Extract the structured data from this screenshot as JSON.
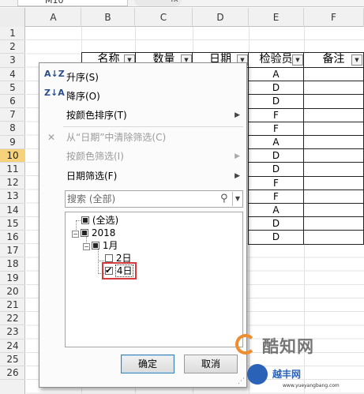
{
  "formula_bar": {
    "name_box": "M10",
    "fx": "fx"
  },
  "columns": [
    "A",
    "B",
    "C",
    "D",
    "E",
    "F"
  ],
  "rows": [
    "1",
    "2",
    "3",
    "4",
    "5",
    "6",
    "7",
    "8",
    "9",
    "10",
    "11",
    "12",
    "13",
    "14",
    "15",
    "16",
    "17",
    "18",
    "19",
    "20",
    "21",
    "22",
    "23",
    "24",
    "25",
    "26"
  ],
  "active_row": "10",
  "table": {
    "headers": [
      "名称",
      "数量",
      "日期",
      "检验员",
      "备注"
    ],
    "filter_glyph": "▼",
    "inspector_values": [
      "A",
      "D",
      "D",
      "F",
      "F",
      "A",
      "D",
      "D",
      "F",
      "F",
      "A",
      "D",
      "D"
    ]
  },
  "filter_menu": {
    "sort_asc": {
      "icon": "A↓Z",
      "label": "升序(S)"
    },
    "sort_desc": {
      "icon": "Z↓A",
      "label": "降序(O)"
    },
    "sort_by_color": {
      "label": "按颜色排序(T)",
      "arrow": "▶"
    },
    "clear_filter": {
      "icon": "✕",
      "label": "从“日期”中清除筛选(C)"
    },
    "filter_by_color": {
      "label": "按颜色筛选(I)",
      "arrow": "▶"
    },
    "date_filters": {
      "label": "日期筛选(F)",
      "arrow": "▶"
    },
    "search": {
      "placeholder": "搜索 (全部)",
      "icon": "⚲",
      "dropdown": "▼"
    },
    "tree": {
      "select_all": "(全选)",
      "year": "2018",
      "month": "1月",
      "day_2": "2日",
      "day_4": "4日",
      "collapse_glyph": "−"
    },
    "ok_label": "确定",
    "cancel_label": "取消",
    "grip": "⋰"
  },
  "watermark": {
    "text_cn": "酷知网",
    "brand": "越丰网",
    "url": "www.yueyangbang.com"
  }
}
